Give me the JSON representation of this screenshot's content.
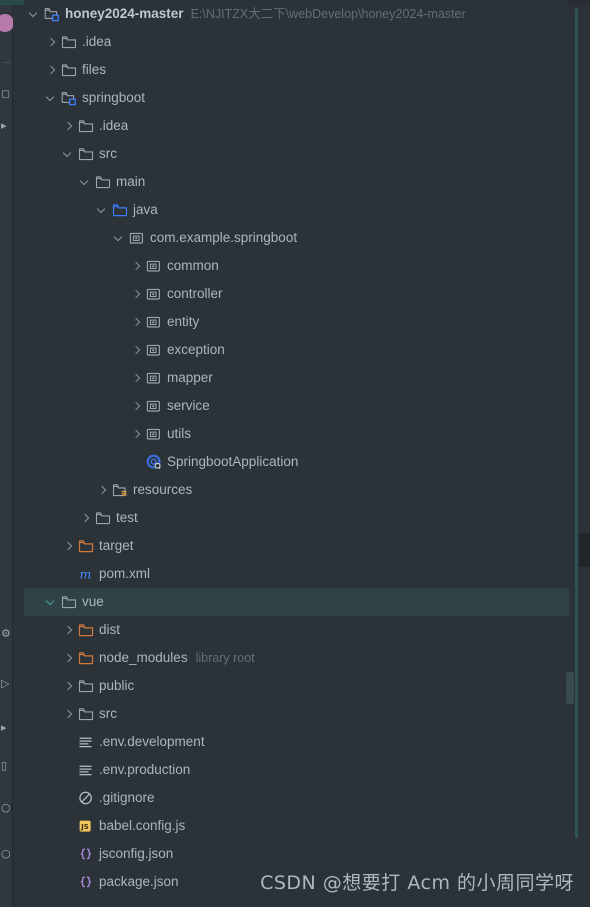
{
  "window": {
    "background_color": "#2b3238",
    "selection_color": "#2f4346",
    "accent_color": "#2d5455"
  },
  "toolstrip": {
    "icons": [
      {
        "name": "user-avatar",
        "glyph": ""
      },
      {
        "name": "project-structure-icon",
        "glyph": "□"
      },
      {
        "name": "bookmark-icon",
        "glyph": "▸"
      },
      {
        "name": "settings-icon",
        "glyph": "⚙"
      },
      {
        "name": "run-icon",
        "glyph": "▷"
      },
      {
        "name": "debug-icon",
        "glyph": "▸"
      },
      {
        "name": "terminal-icon",
        "glyph": "▭"
      },
      {
        "name": "git-icon",
        "glyph": "○"
      },
      {
        "name": "services-icon",
        "glyph": "○"
      }
    ]
  },
  "tree": {
    "rows": [
      {
        "indent": 0,
        "chevron": "down",
        "icon": "module",
        "label": "honey2024-master",
        "sub": "E:\\NJITZX大二下\\webDevelop\\honey2024-master",
        "bold": true,
        "selected": false
      },
      {
        "indent": 1,
        "chevron": "right",
        "icon": "folder",
        "label": ".idea",
        "sub": "",
        "bold": false,
        "selected": false
      },
      {
        "indent": 1,
        "chevron": "right",
        "icon": "folder",
        "label": "files",
        "sub": "",
        "bold": false,
        "selected": false
      },
      {
        "indent": 1,
        "chevron": "down",
        "icon": "module",
        "label": "springboot",
        "sub": "",
        "bold": false,
        "selected": false
      },
      {
        "indent": 2,
        "chevron": "right",
        "icon": "folder",
        "label": ".idea",
        "sub": "",
        "bold": false,
        "selected": false
      },
      {
        "indent": 2,
        "chevron": "down",
        "icon": "folder",
        "label": "src",
        "sub": "",
        "bold": false,
        "selected": false
      },
      {
        "indent": 3,
        "chevron": "down",
        "icon": "folder",
        "label": "main",
        "sub": "",
        "bold": false,
        "selected": false
      },
      {
        "indent": 4,
        "chevron": "down",
        "icon": "source-folder",
        "label": "java",
        "sub": "",
        "bold": false,
        "selected": false
      },
      {
        "indent": 5,
        "chevron": "down",
        "icon": "package",
        "label": "com.example.springboot",
        "sub": "",
        "bold": false,
        "selected": false
      },
      {
        "indent": 6,
        "chevron": "right",
        "icon": "package",
        "label": "common",
        "sub": "",
        "bold": false,
        "selected": false
      },
      {
        "indent": 6,
        "chevron": "right",
        "icon": "package",
        "label": "controller",
        "sub": "",
        "bold": false,
        "selected": false
      },
      {
        "indent": 6,
        "chevron": "right",
        "icon": "package",
        "label": "entity",
        "sub": "",
        "bold": false,
        "selected": false
      },
      {
        "indent": 6,
        "chevron": "right",
        "icon": "package",
        "label": "exception",
        "sub": "",
        "bold": false,
        "selected": false
      },
      {
        "indent": 6,
        "chevron": "right",
        "icon": "package",
        "label": "mapper",
        "sub": "",
        "bold": false,
        "selected": false
      },
      {
        "indent": 6,
        "chevron": "right",
        "icon": "package",
        "label": "service",
        "sub": "",
        "bold": false,
        "selected": false
      },
      {
        "indent": 6,
        "chevron": "right",
        "icon": "package",
        "label": "utils",
        "sub": "",
        "bold": false,
        "selected": false
      },
      {
        "indent": 6,
        "chevron": "none",
        "icon": "spring-class",
        "label": "SpringbootApplication",
        "sub": "",
        "bold": false,
        "selected": false
      },
      {
        "indent": 4,
        "chevron": "right",
        "icon": "resources-folder",
        "label": "resources",
        "sub": "",
        "bold": false,
        "selected": false
      },
      {
        "indent": 3,
        "chevron": "right",
        "icon": "folder",
        "label": "test",
        "sub": "",
        "bold": false,
        "selected": false
      },
      {
        "indent": 2,
        "chevron": "right",
        "icon": "excluded-folder",
        "label": "target",
        "sub": "",
        "bold": false,
        "selected": false
      },
      {
        "indent": 2,
        "chevron": "none",
        "icon": "maven",
        "label": "pom.xml",
        "sub": "",
        "bold": false,
        "selected": false
      },
      {
        "indent": 1,
        "chevron": "down",
        "icon": "folder",
        "label": "vue",
        "sub": "",
        "bold": false,
        "selected": true
      },
      {
        "indent": 2,
        "chevron": "right",
        "icon": "excluded-folder",
        "label": "dist",
        "sub": "",
        "bold": false,
        "selected": false
      },
      {
        "indent": 2,
        "chevron": "right",
        "icon": "excluded-folder",
        "label": "node_modules",
        "sub": "library root",
        "bold": false,
        "selected": false
      },
      {
        "indent": 2,
        "chevron": "right",
        "icon": "folder",
        "label": "public",
        "sub": "",
        "bold": false,
        "selected": false
      },
      {
        "indent": 2,
        "chevron": "right",
        "icon": "folder",
        "label": "src",
        "sub": "",
        "bold": false,
        "selected": false
      },
      {
        "indent": 2,
        "chevron": "none",
        "icon": "text-file",
        "label": ".env.development",
        "sub": "",
        "bold": false,
        "selected": false
      },
      {
        "indent": 2,
        "chevron": "none",
        "icon": "text-file",
        "label": ".env.production",
        "sub": "",
        "bold": false,
        "selected": false
      },
      {
        "indent": 2,
        "chevron": "none",
        "icon": "gitignore",
        "label": ".gitignore",
        "sub": "",
        "bold": false,
        "selected": false
      },
      {
        "indent": 2,
        "chevron": "none",
        "icon": "js-file",
        "label": "babel.config.js",
        "sub": "",
        "bold": false,
        "selected": false
      },
      {
        "indent": 2,
        "chevron": "none",
        "icon": "json-file",
        "label": "jsconfig.json",
        "sub": "",
        "bold": false,
        "selected": false
      },
      {
        "indent": 2,
        "chevron": "none",
        "icon": "json-file",
        "label": "package.json",
        "sub": "",
        "bold": false,
        "selected": false
      }
    ]
  },
  "watermark": {
    "text": "CSDN @想要打 Acm 的小周同学呀"
  }
}
